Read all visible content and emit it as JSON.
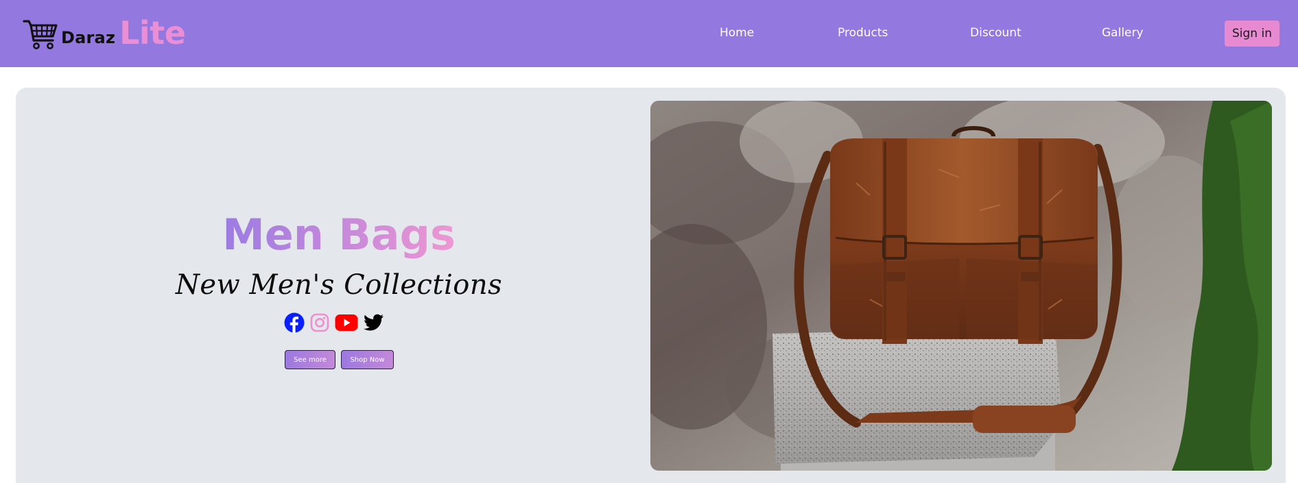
{
  "header": {
    "brand_small": "Daraz",
    "brand_big": "Lite",
    "nav": {
      "home": "Home",
      "products": "Products",
      "discount": "Discount",
      "gallery": "Gallery"
    },
    "signin_label": "Sign in"
  },
  "hero": {
    "title": "Men Bags",
    "subtitle": "New Men's Collections",
    "social_icons": [
      "facebook-icon",
      "instagram-icon",
      "youtube-icon",
      "twitter-icon"
    ],
    "see_more_label": "See more",
    "shop_now_label": "Shop Now"
  },
  "colors": {
    "navbar": "#9378df",
    "accent_pink": "#ea8fd6",
    "hero_bg": "#e4e7eb"
  }
}
